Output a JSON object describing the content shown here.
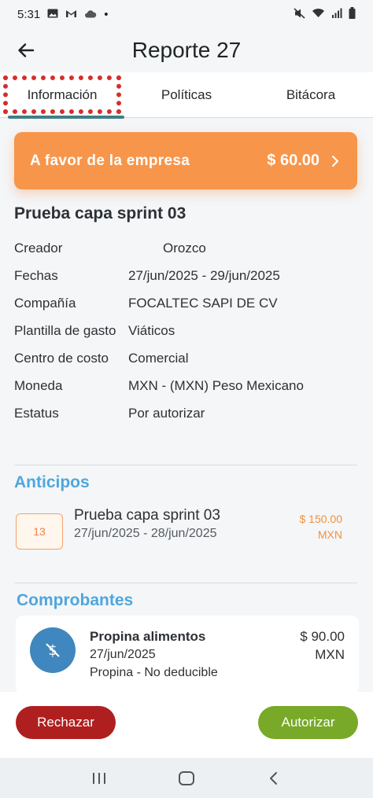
{
  "status_bar": {
    "time": "5:31",
    "dot": "•"
  },
  "header": {
    "title": "Reporte 27"
  },
  "tabs": [
    {
      "label": "Información"
    },
    {
      "label": "Políticas"
    },
    {
      "label": "Bitácora"
    }
  ],
  "balance": {
    "label": "A favor de la empresa",
    "amount": "$ 60.00"
  },
  "report": {
    "name": "Prueba capa sprint 03",
    "rows": [
      {
        "key": "Creador",
        "value": "Orozco"
      },
      {
        "key": "Fechas",
        "value": "27/jun/2025 - 29/jun/2025"
      },
      {
        "key": "Compañía",
        "value": "FOCALTEC SAPI DE CV"
      },
      {
        "key": "Plantilla de gasto",
        "value": "Viáticos"
      },
      {
        "key": "Centro de costo",
        "value": "Comercial"
      },
      {
        "key": "Moneda",
        "value": "MXN - (MXN) Peso Mexicano"
      },
      {
        "key": "Estatus",
        "value": "Por autorizar"
      }
    ]
  },
  "advances": {
    "title": "Anticipos",
    "items": [
      {
        "badge": "13",
        "name": "Prueba capa sprint 03",
        "dates": "27/jun/2025 - 28/jun/2025",
        "amount": "$ 150.00",
        "currency": "MXN"
      }
    ]
  },
  "receipts": {
    "title": "Comprobantes",
    "items": [
      {
        "name": "Propina alimentos",
        "date": "27/jun/2025",
        "category": "Propina - No deducible",
        "amount": "$ 90.00",
        "currency": "MXN"
      }
    ]
  },
  "actions": {
    "reject": "Rechazar",
    "approve": "Autorizar"
  },
  "colors": {
    "accent_orange": "#f7954a",
    "section_blue": "#4fa6dd",
    "reject_red": "#b01f1f",
    "approve_green": "#78a928",
    "tab_indicator": "#3f7f85",
    "highlight_red": "#d62e2a"
  }
}
